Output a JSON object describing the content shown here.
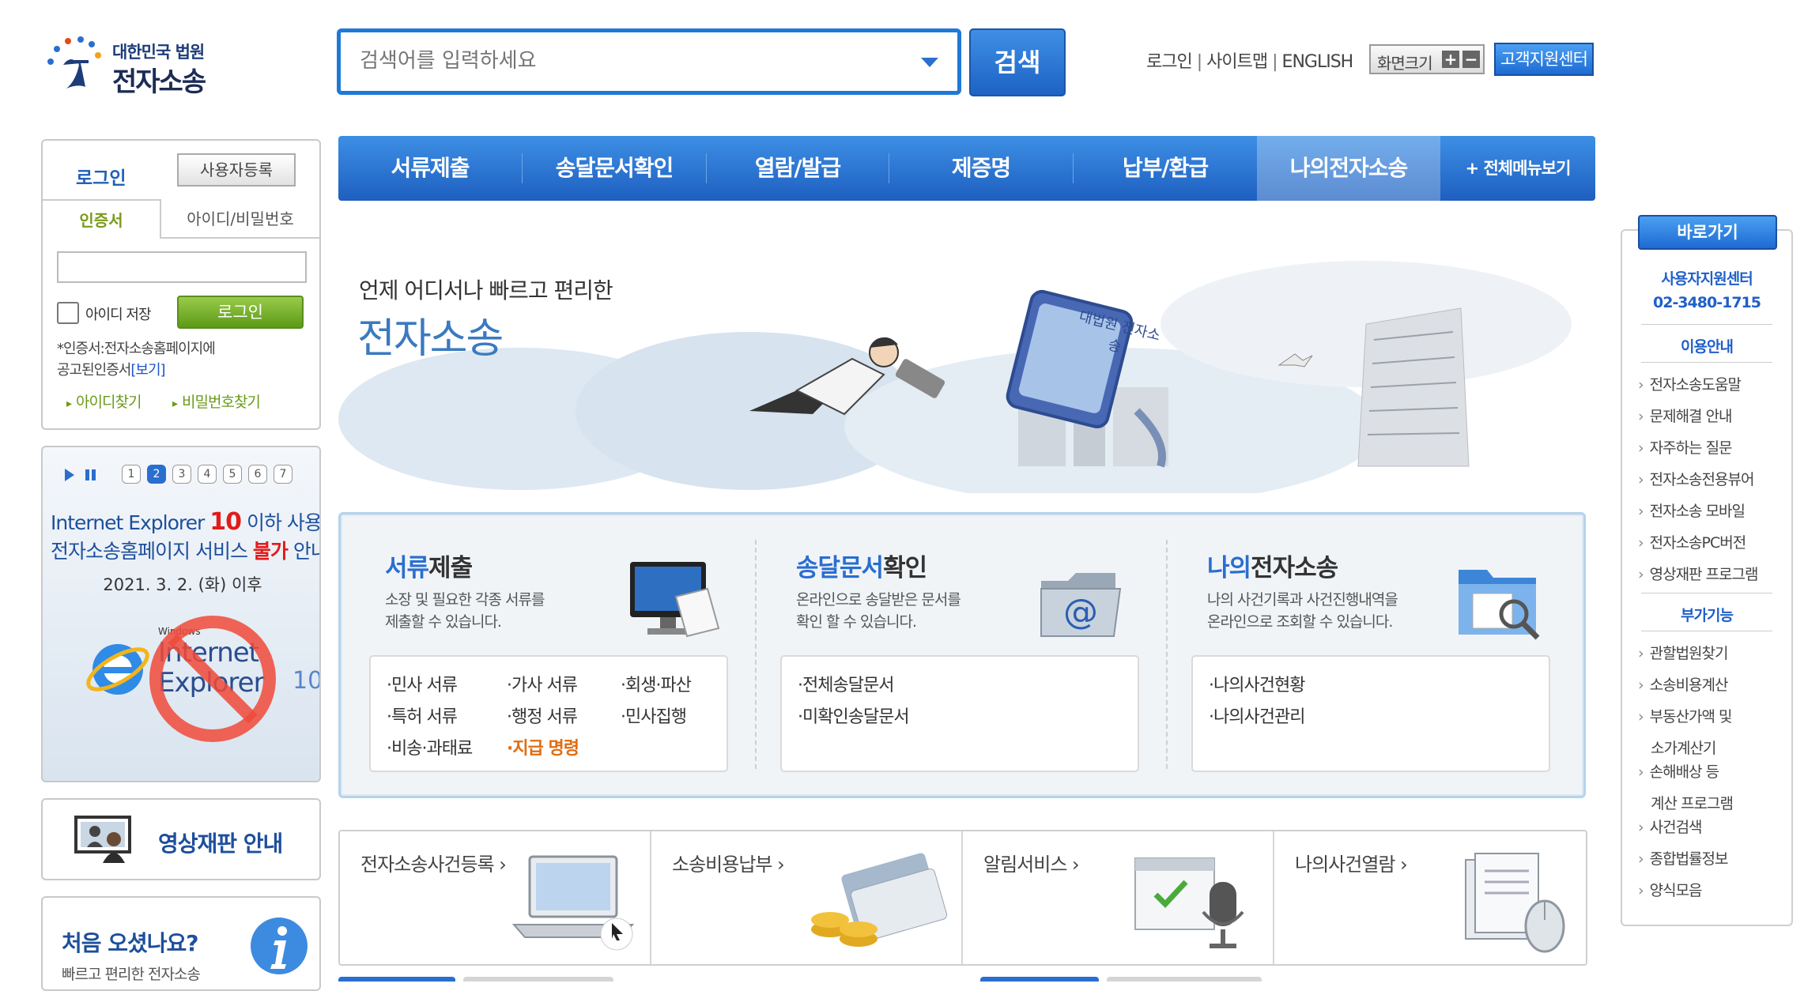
{
  "header": {
    "logo_small": "대한민국 법원",
    "logo_big": "전자소송",
    "search_placeholder": "검색어를 입력하세요",
    "search_button": "검색",
    "links": [
      "로그인",
      "사이트맵",
      "ENGLISH"
    ],
    "zoom_label": "화면크기",
    "zoom_in": "+",
    "zoom_out": "−",
    "help_center": "고객지원센터"
  },
  "nav": {
    "items": [
      "서류제출",
      "송달문서확인",
      "열람/발급",
      "제증명",
      "납부/환급",
      "나의전자소송"
    ],
    "all_menu": "+ 전체메뉴보기",
    "active_index": 5
  },
  "login": {
    "title": "로그인",
    "register": "사용자등록",
    "tab_cert": "인증서",
    "tab_id": "아이디/비밀번호",
    "save_id": "아이디 저장",
    "login_button": "로그인",
    "note_line1": "*인증서:전자소송홈페이지에",
    "note_line2": "공고된인증서",
    "note_link": "[보기]",
    "find_id": "아이디찾기",
    "find_pw": "비밀번호찾기"
  },
  "notice": {
    "pages": [
      "1",
      "2",
      "3",
      "4",
      "5",
      "6",
      "7"
    ],
    "current_page": 2,
    "line1_pre": "Internet Explorer ",
    "line1_num": "10",
    "line1_post": " 이하 사용자",
    "line2_pre": "전자소송홈페이지 서비스 ",
    "line2_red": "불가",
    "line2_post": " 안내",
    "date": "2021. 3. 2. (화) 이후",
    "ie_small": "Windows",
    "ie_big": "Internet",
    "ie_big2": "Explorer",
    "ie_ver": "10"
  },
  "video_trial": {
    "label": "영상재판 안내"
  },
  "first_visit": {
    "title": "처음 오셨나요?",
    "subtitle": "빠르고 편리한 전자소송"
  },
  "banner": {
    "subtitle": "언제 어디서나 빠르고 편리한",
    "title": "전자소송",
    "sign_text": "대법원 전자소송"
  },
  "services": [
    {
      "title_hl": "서류",
      "title_rest": "제출",
      "desc1": "소장 및 필요한 각종 서류를",
      "desc2": "제출할 수 있습니다.",
      "items": [
        "·민사 서류",
        "·가사 서류",
        "·회생·파산",
        "·특허 서류",
        "·행정 서류",
        "·민사집행",
        "·비송·과태료",
        "·지급 명령"
      ]
    },
    {
      "title_hl": "송달문서",
      "title_rest": "확인",
      "desc1": "온라인으로 송달받은 문서를",
      "desc2": "확인 할 수 있습니다.",
      "items": [
        "·전체송달문서",
        "·미확인송달문서"
      ]
    },
    {
      "title_hl": "나의",
      "title_rest": "전자소송",
      "desc1": "나의 사건기록과 사건진행내역을",
      "desc2": "온라인으로 조회할 수 있습니다.",
      "items": [
        "·나의사건현황",
        "·나의사건관리"
      ]
    }
  ],
  "quick_links": [
    "전자소송사건등록 ›",
    "소송비용납부 ›",
    "알림서비스 ›",
    "나의사건열람 ›"
  ],
  "right_bar": {
    "title": "바로가기",
    "support_label": "사용자지원센터",
    "support_phone": "02-3480-1715",
    "usage_title": "이용안내",
    "usage_items": [
      "전자소송도움말",
      "문제해결 안내",
      "자주하는 질문",
      "전자소송전용뷰어",
      "전자소송 모바일",
      "전자소송PC버전",
      "영상재판 프로그램"
    ],
    "extra_title": "부가기능",
    "extra_items": [
      "관할법원찾기",
      "소송비용계산",
      "부동산가액 및",
      "소가계산기",
      "손해배상 등",
      "계산 프로그램",
      "사건검색",
      "종합법률정보",
      "양식모음"
    ]
  },
  "colors": {
    "brand_blue": "#1e62c2",
    "accent_green": "#6aa51c",
    "alert_red": "#e21b1b",
    "orange": "#e06d12"
  }
}
